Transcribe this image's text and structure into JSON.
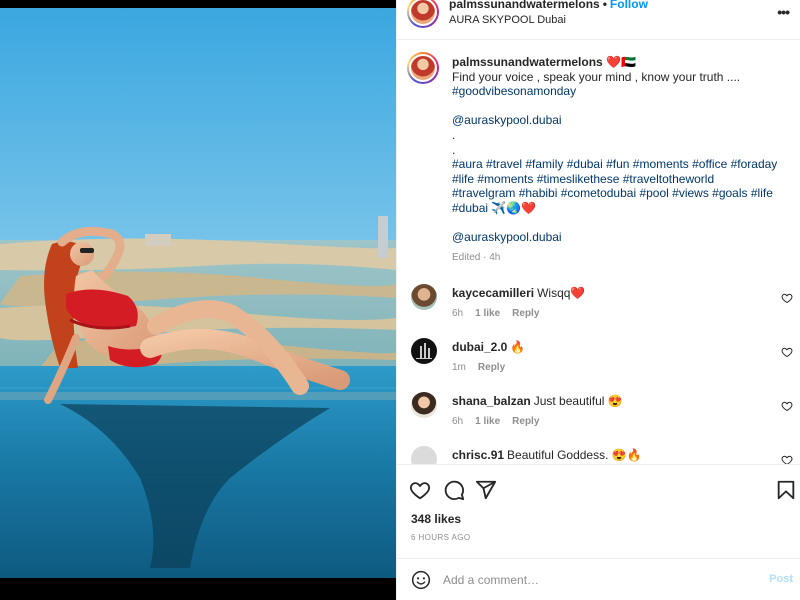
{
  "post": {
    "username": "palmssunandwatermelons",
    "follow_label": "Follow",
    "location": "AURA SKYPOOL Dubai",
    "more_icon": "more-options-icon"
  },
  "caption": {
    "username": "palmssunandwatermelons",
    "user_emoji": "❤️🇦🇪",
    "line1": "Find your voice , speak your mind , know your truth ....",
    "line2": "#goodvibesonamonday",
    "mention1": "@auraskypool.dubai",
    "dot1": ".",
    "dot2": ".",
    "hashtags1": "#aura #travel #family #dubai #fun #moments #office #foraday",
    "hashtags2": "#life #moments #timeslikethese #traveltotheworld",
    "hashtags3": "#travelgram #habibi #cometodubai #pool #views #goals #life",
    "hashtags4": "#dubai ✈️🌏❤️",
    "mention2": "@auraskypool.dubai",
    "edited": "Edited · 4h"
  },
  "comments": [
    {
      "username": "kaycecamilleri",
      "text": "Wisqq❤️",
      "time": "6h",
      "likes": "1 like",
      "reply": "Reply"
    },
    {
      "username": "dubai_2.0",
      "text": "🔥",
      "time": "1m",
      "likes": "",
      "reply": "Reply"
    },
    {
      "username": "shana_balzan",
      "text": "Just beautiful 😍",
      "time": "6h",
      "likes": "1 like",
      "reply": "Reply"
    },
    {
      "username": "chrisc.91",
      "text": "Beautiful Goddess. 😍🔥",
      "time": "",
      "likes": "",
      "reply": ""
    }
  ],
  "actions": {
    "like_icon": "heart-icon",
    "comment_icon": "comment-icon",
    "share_icon": "share-icon",
    "save_icon": "bookmark-icon",
    "likes_count": "348 likes",
    "time_ago": "6 HOURS AGO"
  },
  "add_comment": {
    "placeholder": "Add a comment…",
    "post_label": "Post"
  },
  "colors": {
    "link": "#00376b",
    "follow": "#0095f6",
    "post_disabled": "#b2dffc",
    "muted": "#8e8e8e"
  }
}
